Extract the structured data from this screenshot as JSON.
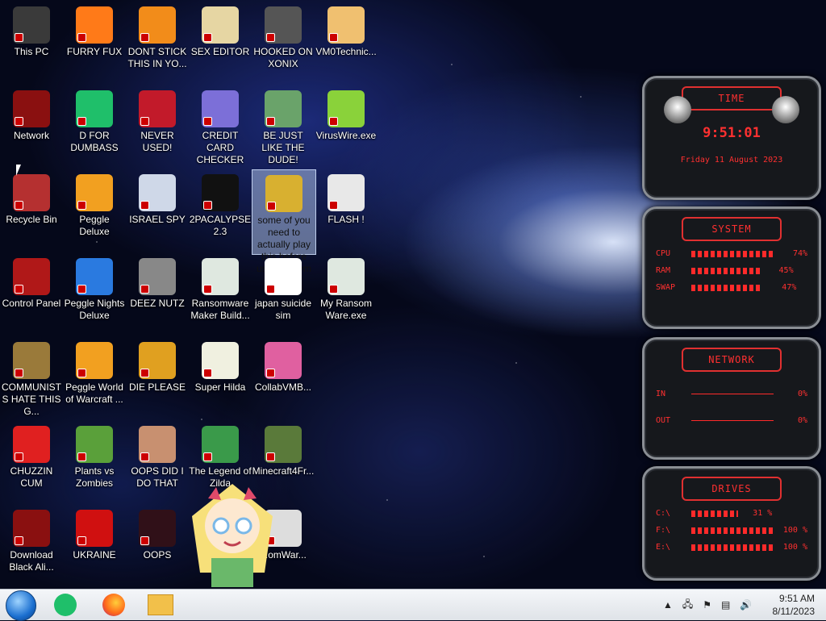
{
  "desktop": {
    "icons": [
      {
        "label": "This PC",
        "col": 0,
        "row": 0,
        "icon": "computer-icon",
        "color": "#3a3a3a"
      },
      {
        "label": "FURRY FUX",
        "col": 1,
        "row": 0,
        "icon": "firefox-icon",
        "color": "#ff7a18"
      },
      {
        "label": "DONT STICK THIS IN YO...",
        "col": 2,
        "row": 0,
        "icon": "traffic-cone-icon",
        "color": "#f28c1a"
      },
      {
        "label": "SEX EDITOR",
        "col": 3,
        "row": 0,
        "icon": "xd-editor-icon",
        "color": "#e6d6a3"
      },
      {
        "label": "HOOKED ON XONIX",
        "col": 4,
        "row": 0,
        "icon": "xonix-game-icon",
        "color": "#555555"
      },
      {
        "label": "VM0Technic...",
        "col": 5,
        "row": 0,
        "icon": "technician-icon",
        "color": "#f0c070"
      },
      {
        "label": "Network",
        "col": 0,
        "row": 1,
        "icon": "alien-network-icon",
        "color": "#8a1010"
      },
      {
        "label": "D FOR DUMBASS",
        "col": 1,
        "row": 1,
        "icon": "green-doc-icon",
        "color": "#1fbf6a"
      },
      {
        "label": "NEVER USED!",
        "col": 2,
        "row": 1,
        "icon": "devcpp-icon",
        "color": "#c21a2a"
      },
      {
        "label": "CREDIT CARD CHECKER",
        "col": 3,
        "row": 1,
        "icon": "credit-card-icon",
        "color": "#7c6fd8"
      },
      {
        "label": "BE JUST LIKE THE DUDE!",
        "col": 4,
        "row": 1,
        "icon": "elf-icon",
        "color": "#6aa36a"
      },
      {
        "label": "VirusWire.exe",
        "col": 5,
        "row": 1,
        "icon": "lime-icon",
        "color": "#8ad23a"
      },
      {
        "label": "Recycle Bin",
        "col": 0,
        "row": 2,
        "icon": "recycle-bin-icon",
        "color": "#b53030"
      },
      {
        "label": "Peggle Deluxe",
        "col": 1,
        "row": 2,
        "icon": "peggle-icon",
        "color": "#f2a020"
      },
      {
        "label": "ISRAEL SPY",
        "col": 2,
        "row": 2,
        "icon": "network-spy-icon",
        "color": "#cfd8e8"
      },
      {
        "label": "2PACALYPSE 2.3",
        "col": 3,
        "row": 2,
        "icon": "terminal-icon",
        "color": "#111111"
      },
      {
        "label": "some of you need to actually play this before using the vm",
        "col": 4,
        "row": 2,
        "icon": "dog-game-icon",
        "color": "#d8b030",
        "selected": true
      },
      {
        "label": "FLASH !",
        "col": 5,
        "row": 2,
        "icon": "flash-doc-icon",
        "color": "#e8e8e8"
      },
      {
        "label": "Control Panel",
        "col": 0,
        "row": 3,
        "icon": "control-panel-icon",
        "color": "#b01818"
      },
      {
        "label": "Peggle Nights Deluxe",
        "col": 1,
        "row": 3,
        "icon": "peggle-nights-icon",
        "color": "#2a7ae0"
      },
      {
        "label": "DEEZ NUTZ",
        "col": 2,
        "row": 3,
        "icon": "stack-windows-icon",
        "color": "#888888"
      },
      {
        "label": "Ransomware Maker Build...",
        "col": 3,
        "row": 3,
        "icon": "app-window-icon",
        "color": "#dfe8e0"
      },
      {
        "label": "japan suicide sim",
        "col": 4,
        "row": 3,
        "icon": "sim-game-icon",
        "color": "#ffffff"
      },
      {
        "label": "My Ransom Ware.exe",
        "col": 5,
        "row": 3,
        "icon": "app-window-icon",
        "color": "#dfe8e0"
      },
      {
        "label": "COMMUNISTS HATE THIS G...",
        "col": 0,
        "row": 4,
        "icon": "money-bag-icon",
        "color": "#9a7a3a"
      },
      {
        "label": "Peggle World of Warcraft ...",
        "col": 1,
        "row": 4,
        "icon": "peggle-wow-icon",
        "color": "#f2a020"
      },
      {
        "label": "DIE PLEASE",
        "col": 2,
        "row": 4,
        "icon": "de-icon",
        "color": "#e0a020"
      },
      {
        "label": "Super Hilda",
        "col": 3,
        "row": 4,
        "icon": "pixel-dog-icon",
        "color": "#f0f0e0"
      },
      {
        "label": "CollabVMB...",
        "col": 4,
        "row": 4,
        "icon": "collabvm-icon",
        "color": "#e060a0"
      },
      {
        "label": "CHUZZIN CUM",
        "col": 0,
        "row": 5,
        "icon": "chuzzle-icon",
        "color": "#e02020"
      },
      {
        "label": "Plants vs Zombies",
        "col": 1,
        "row": 5,
        "icon": "plant-icon",
        "color": "#5aa03a"
      },
      {
        "label": "OOPS DID I DO THAT",
        "col": 2,
        "row": 5,
        "icon": "portrait-icon",
        "color": "#c89070"
      },
      {
        "label": "The Legend of Zilda",
        "col": 3,
        "row": 5,
        "icon": "zelda-icon",
        "color": "#3a9a4a"
      },
      {
        "label": "Minecraft4Fr...",
        "col": 4,
        "row": 5,
        "icon": "minecraft-icon",
        "color": "#5a7a3a"
      },
      {
        "label": "Download Black Ali...",
        "col": 0,
        "row": 6,
        "icon": "alien-icon",
        "color": "#8a1010"
      },
      {
        "label": "UKRAINE",
        "col": 1,
        "row": 6,
        "icon": "radiation-icon",
        "color": "#d01010"
      },
      {
        "label": "OOPS",
        "col": 2,
        "row": 6,
        "icon": "dark-app-icon",
        "color": "#301018"
      },
      {
        "label": "...omWar...",
        "col": 4,
        "row": 6,
        "icon": "skull-icon",
        "color": "#dddddd"
      }
    ]
  },
  "widgets": {
    "time": {
      "head": "TIME",
      "clock": "9:51:01",
      "date": "Friday 11 August 2023"
    },
    "system": {
      "head": "SYSTEM",
      "rows": [
        {
          "k": "CPU",
          "v": "74%",
          "fill": 0.74
        },
        {
          "k": "RAM",
          "v": "45%",
          "fill": 0.45
        },
        {
          "k": "SWAP",
          "v": "47%",
          "fill": 0.47
        }
      ]
    },
    "network": {
      "head": "NETWORK",
      "rows": [
        {
          "k": "IN",
          "v": "0%"
        },
        {
          "k": "OUT",
          "v": "0%"
        }
      ]
    },
    "drives": {
      "head": "DRIVES",
      "rows": [
        {
          "k": "C:\\",
          "v": "31 %",
          "fill": 0.31
        },
        {
          "k": "F:\\",
          "v": "100 %",
          "fill": 1.0
        },
        {
          "k": "E:\\",
          "v": "100 %",
          "fill": 1.0
        }
      ]
    }
  },
  "taskbar": {
    "items": [
      "start-orb-icon",
      "green-doc-icon",
      "firefox-icon",
      "file-explorer-icon"
    ],
    "tray_icons": [
      "chevron-up-icon",
      "network-share-icon",
      "flag-icon",
      "ethernet-icon",
      "volume-icon"
    ],
    "time": "9:51 AM",
    "date": "8/11/2023"
  }
}
